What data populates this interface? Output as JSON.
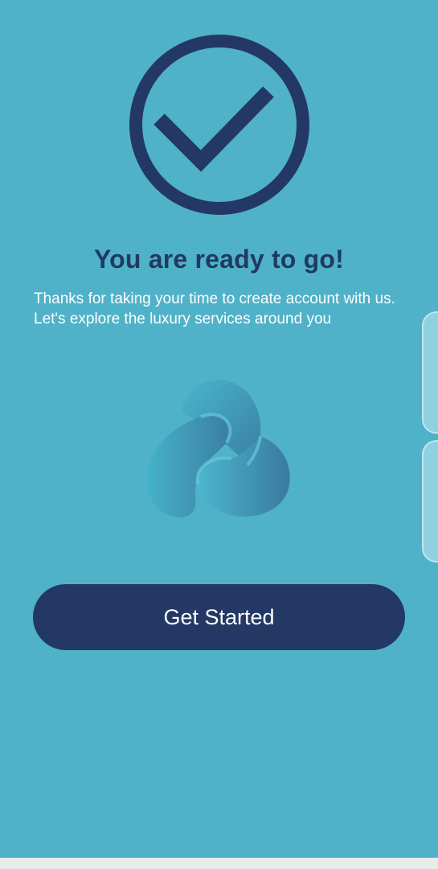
{
  "welcome": {
    "status_icon": "check-circle-icon",
    "title": "You are ready to go!",
    "description": "Thanks for taking your time to create account with us. Let's explore the luxury services around you",
    "brand_logo": "trefoil-logo-icon",
    "cta_label": "Get Started"
  },
  "colors": {
    "background": "#4fb2c9",
    "primary_navy": "#243865",
    "title_text": "#1f3a63",
    "body_text": "#ffffff",
    "logo_gradient_start": "#49b6cc",
    "logo_gradient_end": "#3a7ea3"
  }
}
